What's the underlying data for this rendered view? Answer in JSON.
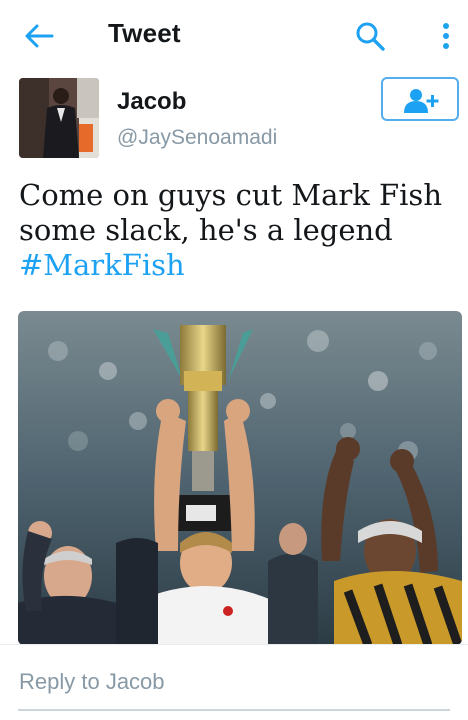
{
  "header": {
    "title": "Tweet",
    "back_icon": "arrow-left-icon",
    "search_icon": "search-icon",
    "more_icon": "more-vertical-icon",
    "accent_color": "#1da1f2"
  },
  "tweet": {
    "author_name": "Jacob",
    "author_handle": "@JaySenoamadi",
    "follow_icon": "add-user-icon",
    "text": "Come on guys cut Mark Fish some slack, he's a legend",
    "hashtag": "#MarkFish",
    "media_alt": "photo-footballer-holding-trophy"
  },
  "reply": {
    "placeholder": "Reply to Jacob"
  }
}
